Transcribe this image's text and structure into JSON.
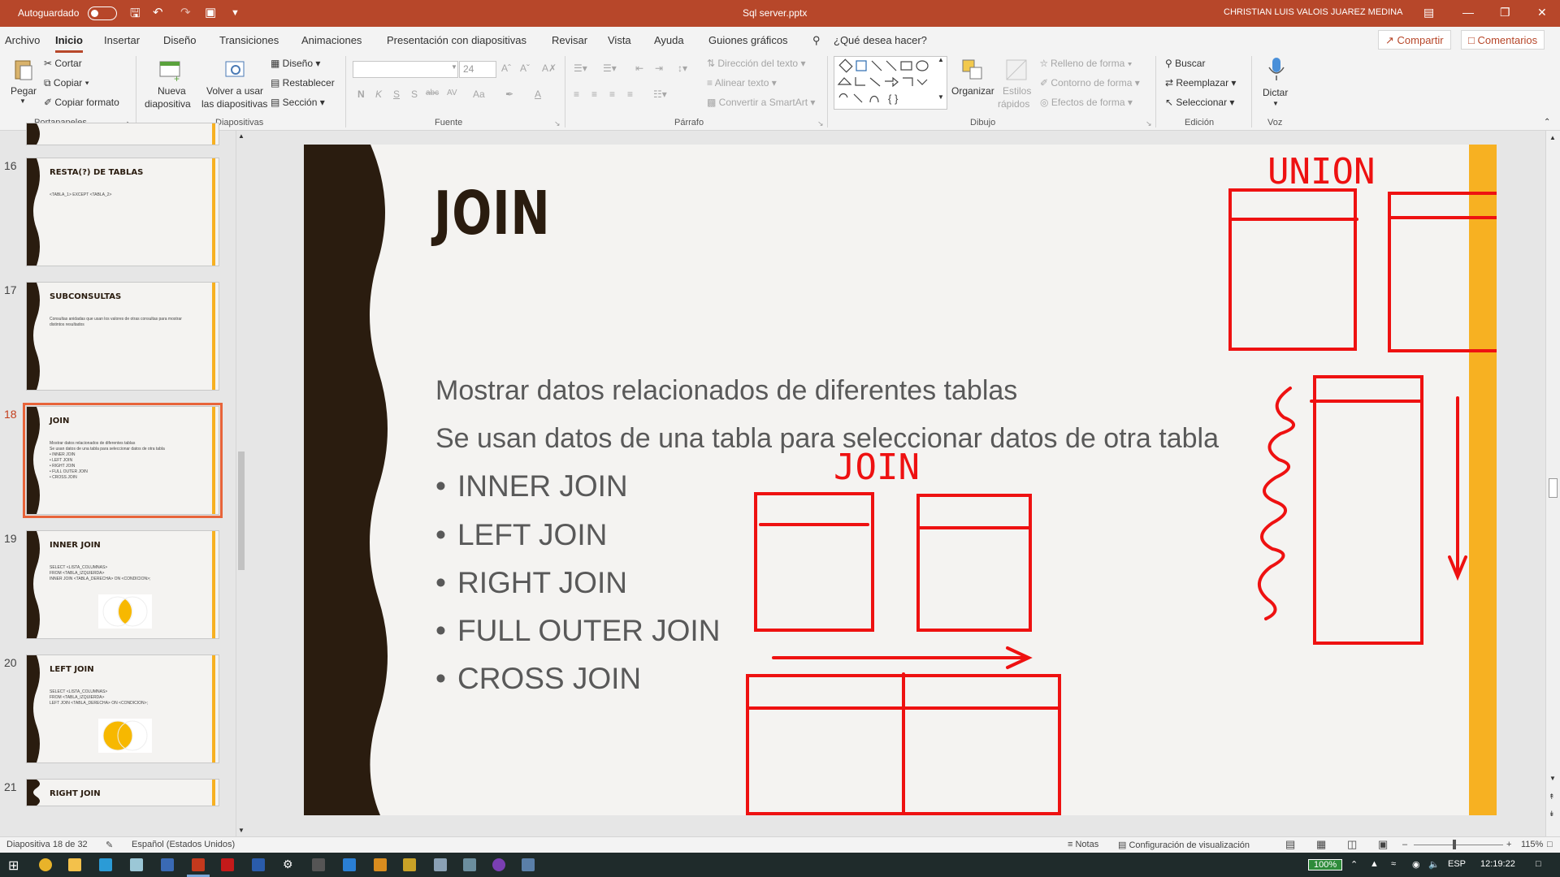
{
  "titlebar": {
    "autosave_label": "Autoguardado",
    "filename": "Sql server.pptx",
    "user": "CHRISTIAN LUIS VALOIS JUAREZ MEDINA"
  },
  "tabs": [
    "Archivo",
    "Inicio",
    "Insertar",
    "Diseño",
    "Transiciones",
    "Animaciones",
    "Presentación con diapositivas",
    "Revisar",
    "Vista",
    "Ayuda",
    "Guiones gráficos"
  ],
  "tell_me": "¿Qué desea hacer?",
  "share_label": "Compartir",
  "comments_label": "Comentarios",
  "ribbon": {
    "clipboard": {
      "paste": "Pegar",
      "cut": "Cortar",
      "copy": "Copiar",
      "format_painter": "Copiar formato",
      "group": "Portapapeles"
    },
    "slides": {
      "new_slide_1": "Nueva",
      "new_slide_2": "diapositiva",
      "reuse_1": "Volver a usar",
      "reuse_2": "las diapositivas",
      "layout": "Diseño",
      "reset": "Restablecer",
      "section": "Sección",
      "group": "Diapositivas"
    },
    "font": {
      "size": "24",
      "bold": "N",
      "italic": "K",
      "underline": "S",
      "shadow": "S",
      "strike": "abc",
      "spacing": "AV",
      "case": "Aa",
      "group": "Fuente"
    },
    "paragraph": {
      "text_direction": "Dirección del texto",
      "align_text": "Alinear texto",
      "smartart": "Convertir a SmartArt",
      "group": "Párrafo"
    },
    "drawing": {
      "arrange": "Organizar",
      "quick_styles_1": "Estilos",
      "quick_styles_2": "rápidos",
      "shape_fill": "Relleno de forma",
      "shape_outline": "Contorno de forma",
      "shape_effects": "Efectos de forma",
      "group": "Dibujo"
    },
    "editing": {
      "find": "Buscar",
      "replace": "Reemplazar",
      "select": "Seleccionar",
      "group": "Edición"
    },
    "voice": {
      "dictate": "Dictar",
      "group": "Voz"
    }
  },
  "thumbnails": [
    {
      "num": "16",
      "title": "RESTA(?) DE TABLAS",
      "body": [
        "<TABLA_1> EXCEPT <TABLA_2>"
      ],
      "venn": "none"
    },
    {
      "num": "17",
      "title": "SUBCONSULTAS",
      "body": [
        "Consultas anidadas que usan los valores de otras consultas para mostrar",
        "distintos resultados"
      ],
      "venn": "none"
    },
    {
      "num": "18",
      "title": "JOIN",
      "body": [
        "Mostrar datos relacionados de diferentes tablas",
        "Se usan datos de una tabla para seleccionar datos de otra tabla",
        "• INNER JOIN",
        "• LEFT JOIN",
        "• RIGHT JOIN",
        "• FULL OUTER JOIN",
        "• CROSS JOIN"
      ],
      "venn": "none",
      "selected": true
    },
    {
      "num": "19",
      "title": "INNER JOIN",
      "body": [
        "SELECT <LISTA_COLUMNAS>",
        "FROM <TABLA_IZQUIERDA>",
        "INNER JOIN <TABLA_DERECHA> ON <CONDICION>;"
      ],
      "venn": "inner"
    },
    {
      "num": "20",
      "title": "LEFT JOIN",
      "body": [
        "SELECT <LISTA_COLUMNAS>",
        "FROM <TABLA_IZQUIERDA>",
        "LEFT JOIN <TABLA_DERECHA> ON <CONDICION>;"
      ],
      "venn": "left"
    },
    {
      "num": "21",
      "title": "RIGHT JOIN",
      "body": [],
      "venn": "none"
    }
  ],
  "slide": {
    "title": "JOIN",
    "line1": "Mostrar datos relacionados de diferentes tablas",
    "line2": "Se usan datos de una tabla para seleccionar datos de otra tabla",
    "bullets": [
      "INNER JOIN",
      "LEFT JOIN",
      "RIGHT JOIN",
      "FULL OUTER JOIN",
      "CROSS JOIN"
    ],
    "ink_union": "UNION",
    "ink_join": "JOIN",
    "ink_color": "#ee1111",
    "accent_color": "#f7b122",
    "wave_color": "#2a1c0f"
  },
  "status": {
    "slide_info": "Diapositiva 18 de 32",
    "language": "Español (Estados Unidos)",
    "notes": "Notas",
    "display_settings": "Configuración de visualización",
    "zoom": "115%"
  },
  "taskbar": {
    "battery": "100%",
    "lang": "ESP",
    "time": "12:19:22"
  }
}
